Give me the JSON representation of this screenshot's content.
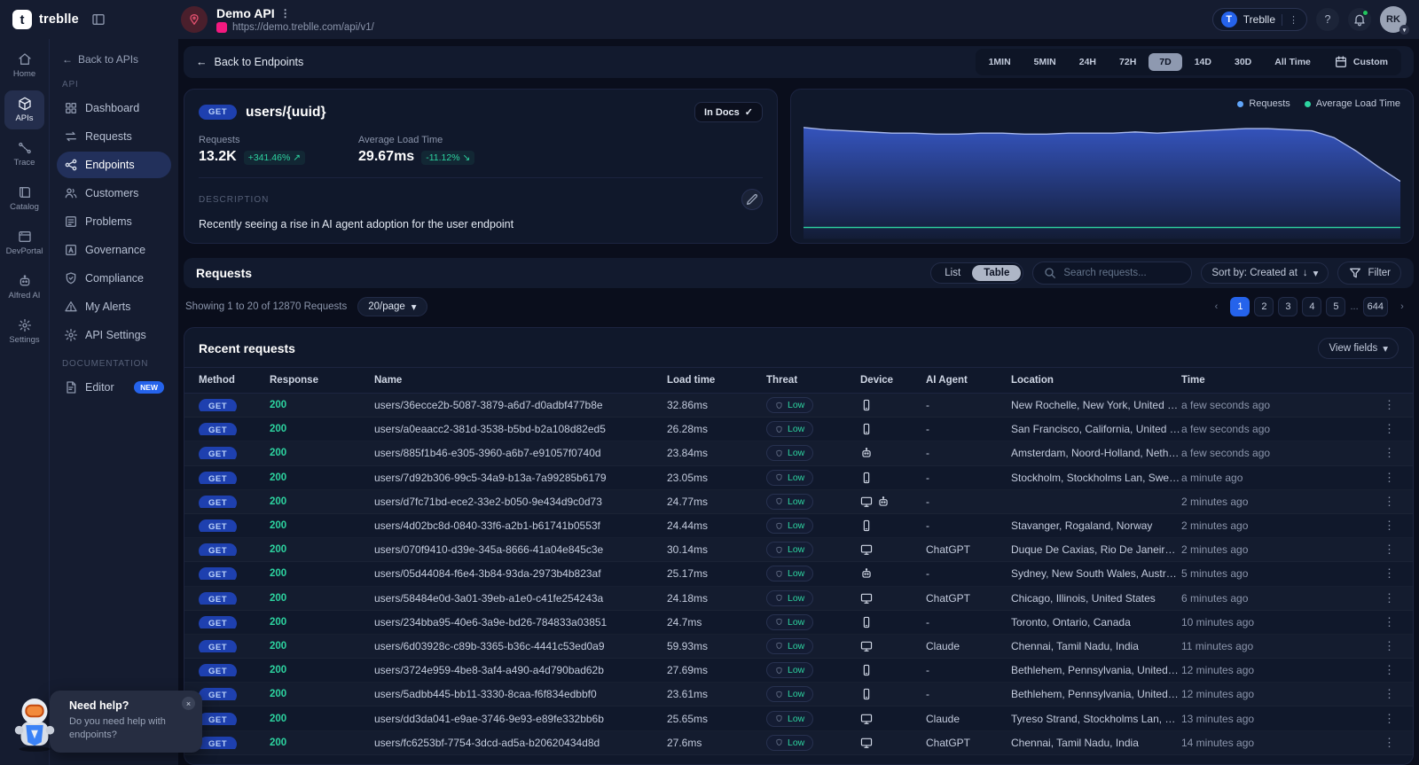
{
  "icons": {
    "caret_down": "▾",
    "arrow_down": "↓",
    "arrow_left": "←",
    "check": "✓",
    "dots_vertical": "⋮",
    "trend_up": "↗",
    "trend_down": "↘",
    "chevron_left": "‹",
    "chevron_right": "›",
    "question": "?",
    "close": "×"
  },
  "header": {
    "brand": "treblle",
    "brand_glyph": "t",
    "api_name": "Demo API",
    "api_url": "https://demo.treblle.com/api/v1/",
    "workspace": "Treblle",
    "workspace_glyph": "T",
    "avatar_initials": "RK"
  },
  "nav_rail": {
    "items": [
      {
        "label": "Home",
        "icon": "home",
        "active": false
      },
      {
        "label": "APIs",
        "icon": "cube",
        "active": true
      },
      {
        "label": "Trace",
        "icon": "trace",
        "active": false
      },
      {
        "label": "Catalog",
        "icon": "catalog",
        "active": false
      },
      {
        "label": "DevPortal",
        "icon": "devportal",
        "active": false
      },
      {
        "label": "Alfred AI",
        "icon": "bot",
        "active": false
      },
      {
        "label": "Settings",
        "icon": "gear",
        "active": false
      }
    ]
  },
  "sidebar": {
    "back_label": "Back to APIs",
    "section_api": "API",
    "items": [
      {
        "label": "Dashboard",
        "icon": "grid"
      },
      {
        "label": "Requests",
        "icon": "swap"
      },
      {
        "label": "Endpoints",
        "icon": "endpoint"
      },
      {
        "label": "Customers",
        "icon": "users"
      },
      {
        "label": "Problems",
        "icon": "problems"
      },
      {
        "label": "Governance",
        "icon": "governance"
      },
      {
        "label": "Compliance",
        "icon": "shield"
      },
      {
        "label": "My Alerts",
        "icon": "warning"
      },
      {
        "label": "API Settings",
        "icon": "gear"
      }
    ],
    "section_docs": "DOCUMENTATION",
    "editor_label": "Editor",
    "editor_badge": "NEW"
  },
  "toolbar": {
    "back_label": "Back to Endpoints",
    "ranges": [
      "1MIN",
      "5MIN",
      "24H",
      "72H",
      "7D",
      "14D",
      "30D",
      "All Time"
    ],
    "active_range": "7D",
    "custom_label": "Custom"
  },
  "endpoint": {
    "method": "GET",
    "path": "users/{uuid}",
    "in_docs": "In Docs",
    "requests_label": "Requests",
    "requests_value": "13.2K",
    "requests_delta": "+341.46%",
    "load_label": "Average Load Time",
    "load_value": "29.67ms",
    "load_delta": "-11.12%",
    "description_label": "DESCRIPTION",
    "description": "Recently seeing a rise in AI agent adoption for the user endpoint"
  },
  "chart_data": {
    "type": "area",
    "title": "Endpoint traffic over selected 7D range",
    "legend": [
      {
        "label": "Requests",
        "color": "#60a5fa"
      },
      {
        "label": "Average Load Time",
        "color": "#2dd4a0"
      }
    ],
    "legend_position": "top-right",
    "axes_visible": false,
    "y_unit": "percent of plot height (no visible axis labels)",
    "series": [
      {
        "name": "Requests",
        "color": "#5b7bd8",
        "values": [
          93,
          91,
          90,
          89,
          88,
          88,
          87,
          87,
          88,
          88,
          87,
          87,
          88,
          88,
          88,
          89,
          88,
          89,
          90,
          91,
          92,
          92,
          91,
          90,
          84,
          72,
          58,
          45
        ]
      },
      {
        "name": "Average Load Time",
        "color": "#2dd4a0",
        "values": [
          4,
          4,
          4,
          4,
          4,
          4,
          4,
          4,
          4,
          4,
          4,
          4,
          4,
          4,
          4,
          4,
          4,
          4,
          4,
          4,
          4,
          4,
          4,
          4,
          4,
          4,
          4,
          4
        ]
      }
    ]
  },
  "requests_section": {
    "title": "Requests",
    "view_list": "List",
    "view_table": "Table",
    "search_placeholder": "Search requests...",
    "sort_label": "Sort by: Created at",
    "filter_label": "Filter",
    "showing": "Showing 1 to 20 of 12870 Requests",
    "per_page": "20/page",
    "pages": [
      "1",
      "2",
      "3",
      "4",
      "5",
      "644"
    ],
    "active_page": "1",
    "ellipsis": "..."
  },
  "table": {
    "title": "Recent requests",
    "view_fields": "View fields",
    "columns": [
      "Method",
      "Response",
      "Name",
      "Load time",
      "Threat",
      "Device",
      "AI Agent",
      "Location",
      "Time"
    ],
    "rows": [
      {
        "method": "GET",
        "response": "200",
        "name": "users/36ecce2b-5087-3879-a6d7-d0adbf477b8e",
        "load": "32.86ms",
        "threat": "Low",
        "device": "phone",
        "ai": "-",
        "location": "New Rochelle, New York, United St...",
        "time": "a few seconds ago"
      },
      {
        "method": "GET",
        "response": "200",
        "name": "users/a0eaacc2-381d-3538-b5bd-b2a108d82ed5",
        "load": "26.28ms",
        "threat": "Low",
        "device": "phone",
        "ai": "-",
        "location": "San Francisco, California, United St...",
        "time": "a few seconds ago"
      },
      {
        "method": "GET",
        "response": "200",
        "name": "users/885f1b46-e305-3960-a6b7-e91057f0740d",
        "load": "23.84ms",
        "threat": "Low",
        "device": "bot",
        "ai": "-",
        "location": "Amsterdam, Noord-Holland, Nether...",
        "time": "a few seconds ago"
      },
      {
        "method": "GET",
        "response": "200",
        "name": "users/7d92b306-99c5-34a9-b13a-7a99285b6179",
        "load": "23.05ms",
        "threat": "Low",
        "device": "phone",
        "ai": "-",
        "location": "Stockholm, Stockholms Lan, Sweden",
        "time": "a minute ago"
      },
      {
        "method": "GET",
        "response": "200",
        "name": "users/d7fc71bd-ece2-33e2-b050-9e434d9c0d73",
        "load": "24.77ms",
        "threat": "Low",
        "device": "desktop+bot",
        "ai": "-",
        "location": "",
        "time": "2 minutes ago"
      },
      {
        "method": "GET",
        "response": "200",
        "name": "users/4d02bc8d-0840-33f6-a2b1-b61741b0553f",
        "load": "24.44ms",
        "threat": "Low",
        "device": "phone",
        "ai": "-",
        "location": "Stavanger, Rogaland, Norway",
        "time": "2 minutes ago"
      },
      {
        "method": "GET",
        "response": "200",
        "name": "users/070f9410-d39e-345a-8666-41a04e845c3e",
        "load": "30.14ms",
        "threat": "Low",
        "device": "desktop",
        "ai": "ChatGPT",
        "location": "Duque De Caxias, Rio De Janeiro, B...",
        "time": "2 minutes ago"
      },
      {
        "method": "GET",
        "response": "200",
        "name": "users/05d44084-f6e4-3b84-93da-2973b4b823af",
        "load": "25.17ms",
        "threat": "Low",
        "device": "bot",
        "ai": "-",
        "location": "Sydney, New South Wales, Australia",
        "time": "5 minutes ago"
      },
      {
        "method": "GET",
        "response": "200",
        "name": "users/58484e0d-3a01-39eb-a1e0-c41fe254243a",
        "load": "24.18ms",
        "threat": "Low",
        "device": "desktop",
        "ai": "ChatGPT",
        "location": "Chicago, Illinois, United States",
        "time": "6 minutes ago"
      },
      {
        "method": "GET",
        "response": "200",
        "name": "users/234bba95-40e6-3a9e-bd26-784833a03851",
        "load": "24.7ms",
        "threat": "Low",
        "device": "phone",
        "ai": "-",
        "location": "Toronto, Ontario, Canada",
        "time": "10 minutes ago"
      },
      {
        "method": "GET",
        "response": "200",
        "name": "users/6d03928c-c89b-3365-b36c-4441c53ed0a9",
        "load": "59.93ms",
        "threat": "Low",
        "device": "desktop",
        "ai": "Claude",
        "location": "Chennai, Tamil Nadu, India",
        "time": "11 minutes ago"
      },
      {
        "method": "GET",
        "response": "200",
        "name": "users/3724e959-4be8-3af4-a490-a4d790bad62b",
        "load": "27.69ms",
        "threat": "Low",
        "device": "phone",
        "ai": "-",
        "location": "Bethlehem, Pennsylvania, United St...",
        "time": "12 minutes ago"
      },
      {
        "method": "GET",
        "response": "200",
        "name": "users/5adbb445-bb11-3330-8caa-f6f834edbbf0",
        "load": "23.61ms",
        "threat": "Low",
        "device": "phone",
        "ai": "-",
        "location": "Bethlehem, Pennsylvania, United St...",
        "time": "12 minutes ago"
      },
      {
        "method": "GET",
        "response": "200",
        "name": "users/dd3da041-e9ae-3746-9e93-e89fe332bb6b",
        "load": "25.65ms",
        "threat": "Low",
        "device": "desktop",
        "ai": "Claude",
        "location": "Tyreso Strand, Stockholms Lan, Sw...",
        "time": "13 minutes ago"
      },
      {
        "method": "GET",
        "response": "200",
        "name": "users/fc6253bf-7754-3dcd-ad5a-b20620434d8d",
        "load": "27.6ms",
        "threat": "Low",
        "device": "desktop",
        "ai": "ChatGPT",
        "location": "Chennai, Tamil Nadu, India",
        "time": "14 minutes ago"
      }
    ]
  },
  "chat": {
    "title": "Need help?",
    "message": "Do you need help with endpoints?"
  },
  "colors": {
    "accent_blue": "#2563eb",
    "accent_green": "#2dd4a0",
    "badge_get_bg": "#1e40af",
    "env_badge_pink": "#f3197f",
    "panel_bg": "#151c30",
    "content_bg": "#0a0e1c",
    "card_bg": "#10182b"
  }
}
